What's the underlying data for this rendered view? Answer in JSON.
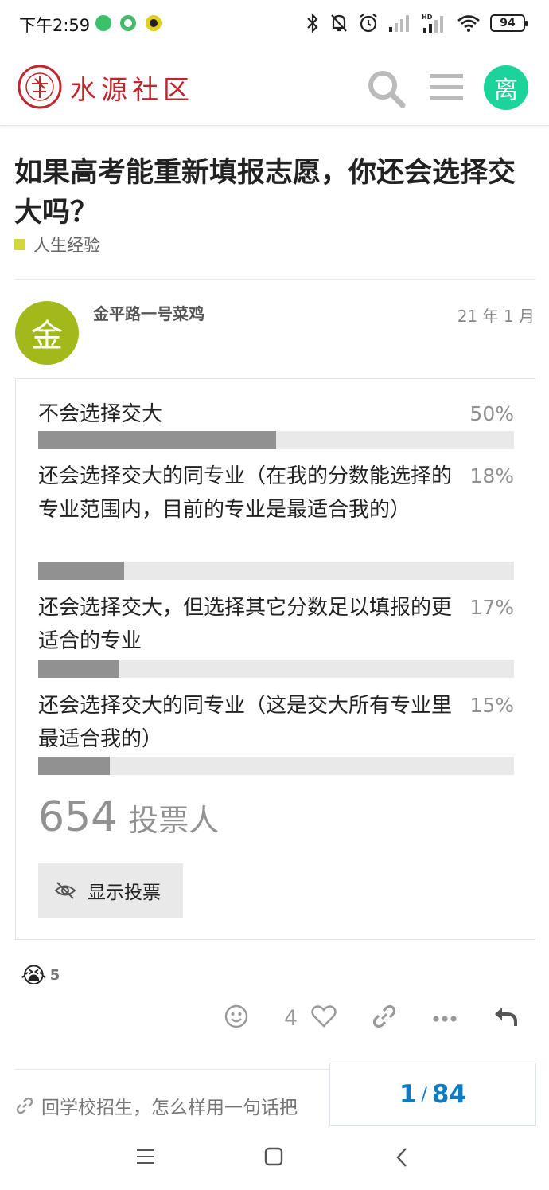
{
  "status_bar": {
    "time": "下午2:59",
    "battery": "94",
    "app_dots": [
      "#3ac26b",
      "#46b96a",
      "#e3cf1b"
    ]
  },
  "header": {
    "logo_text": "水源社区",
    "avatar_letter": "离",
    "avatar_color": "#1bd39b"
  },
  "topic": {
    "title": "如果高考能重新填报志愿，你还会选择交大吗？",
    "category": "人生经验",
    "category_color": "#d3d63f"
  },
  "post": {
    "avatar_letter": "金",
    "avatar_color": "#a3b81b",
    "username": "金平路一号菜鸡",
    "date": "21 年 1 月"
  },
  "poll": {
    "options": [
      {
        "text": "不会选择交大",
        "percent_label": "50%",
        "percent": 50
      },
      {
        "text": "还会选择交大的同专业（在我的分数能选择的专业范围内，目前的专业是最适合我的）",
        "percent_label": "18%",
        "percent": 18
      },
      {
        "text": "还会选择交大，但选择其它分数足以填报的更适合的专业",
        "percent_label": "17%",
        "percent": 17
      },
      {
        "text": "还会选择交大的同专业（这是交大所有专业里最适合我的）",
        "percent_label": "15%",
        "percent": 15
      }
    ],
    "voters_count": "654",
    "voters_label": "投票人",
    "show_votes_label": "显示投票"
  },
  "reactions": {
    "emoji": "😭",
    "count": "5"
  },
  "actions": {
    "like_count": "4"
  },
  "linked_topic": {
    "text": "回学校招生，怎么样用一句话把"
  },
  "progress": {
    "current": "1",
    "total": "84"
  }
}
